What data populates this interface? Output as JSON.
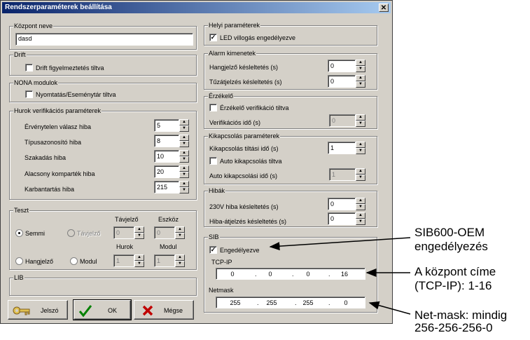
{
  "window": {
    "title": "Rendszerparaméterek beállítása",
    "close_glyph": "✕"
  },
  "kozpont_nev": {
    "legend": "Központ neve",
    "value": "dasd"
  },
  "drift": {
    "legend": "Drift",
    "checkbox_label": "Drift figyelmeztetés tiltva",
    "checked": false
  },
  "nona": {
    "legend": "NONA modulok",
    "checkbox_label": "Nyomtatás/Eseménytár tiltva",
    "checked": false
  },
  "hurok_verif": {
    "legend": "Hurok verifikációs paraméterek",
    "rows": [
      {
        "label": "Érvénytelen válasz hiba",
        "value": "5"
      },
      {
        "label": "Típusazonosító hiba",
        "value": "8"
      },
      {
        "label": "Szakadás hiba",
        "value": "10"
      },
      {
        "label": "Alacsony komparték hiba",
        "value": "20"
      },
      {
        "label": "Karbantartás hiba",
        "value": "215"
      }
    ]
  },
  "teszt": {
    "legend": "Teszt",
    "col_tavjelzo": "Távjelző",
    "col_eszkoz": "Eszköz",
    "col_hurok": "Hurok",
    "col_modul": "Modul",
    "radio_semmi": "Semmi",
    "radio_tavjelzo": "Távjelző",
    "radio_hangjelzo": "Hangjelző",
    "radio_modul": "Modul",
    "tavjelzo_value": "0",
    "eszkoz_value": "0",
    "hurok_value": "1",
    "modul_value": "1"
  },
  "lib": {
    "legend": "LIB"
  },
  "buttons": {
    "telszo": "Jelszó",
    "ok": "OK",
    "megse": "Mégse"
  },
  "helyi": {
    "legend": "Helyi paraméterek",
    "checkbox_label": "LED villogás engedélyezve",
    "checked": true
  },
  "alarm": {
    "legend": "Alarm kimenetek",
    "rows": [
      {
        "label": "Hangjelző késleltetés (s)",
        "value": "0"
      },
      {
        "label": "Tűzátjelzés késleltetés (s)",
        "value": "0"
      }
    ]
  },
  "erzekelo": {
    "legend": "Érzékelő",
    "checkbox_label": "Érzékelő verifikáció tiltva",
    "checked": false,
    "verif_label": "Verifikációs idő (s)",
    "verif_value": "0"
  },
  "kikapcsolas": {
    "legend": "Kikapcsolás paraméterek",
    "tiltasi_label": "Kikapcsolás tiltási idő (s)",
    "tiltasi_value": "1",
    "auto_checkbox": "Auto kikapcsolás tiltva",
    "auto_checked": false,
    "auto_label": "Auto kikapcsolási idő (s)",
    "auto_value": "1"
  },
  "hibak": {
    "legend": "Hibák",
    "rows": [
      {
        "label": "230V hiba késleltetés (s)",
        "value": "0"
      },
      {
        "label": "Hiba-átjelzés késleltetés (s)",
        "value": "0"
      }
    ]
  },
  "sib": {
    "legend": "SIB",
    "checkbox_label": "Engedélyezve",
    "checked": true,
    "tcpip_label": "TCP-IP",
    "ip": [
      "0",
      "0",
      "0",
      "16"
    ],
    "netmask_label": "Netmask",
    "netmask": [
      "255",
      "255",
      "255",
      "0"
    ]
  },
  "annotations": {
    "sib_l1": "SIB600-OEM",
    "sib_l2": "engedélyezés",
    "ip_l1": "A központ címe",
    "ip_l2": "(TCP-IP): 1-16",
    "mask_l1": "Net-mask: mindig",
    "mask_l2": "256-256-256-0"
  }
}
